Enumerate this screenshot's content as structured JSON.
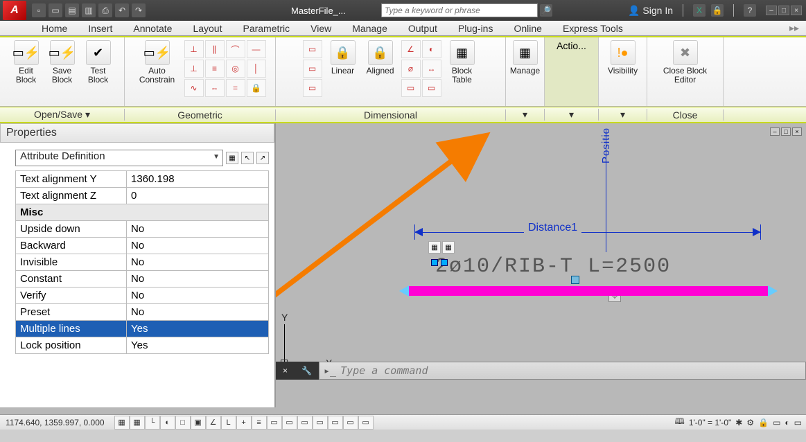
{
  "titlebar": {
    "app_initial": "A",
    "filename": "MasterFile_...",
    "search_placeholder": "Type a keyword or phrase",
    "sign_in": "Sign In"
  },
  "menubar": [
    "Home",
    "Insert",
    "Annotate",
    "Layout",
    "Parametric",
    "View",
    "Manage",
    "Output",
    "Plug-ins",
    "Online",
    "Express Tools"
  ],
  "ribbon": {
    "edit_block": "Edit Block",
    "save_block": "Save Block",
    "test_block": "Test Block",
    "auto_constrain": "Auto Constrain",
    "linear": "Linear",
    "aligned": "Aligned",
    "block_table": "Block Table",
    "manage": "Manage",
    "actio": "Actio...",
    "visibility": "Visibility",
    "close_be": "Close Block Editor",
    "panels": {
      "open_save": "Open/Save",
      "geometric": "Geometric",
      "dimensional": "Dimensional",
      "close": "Close"
    },
    "panel_widths": {
      "open_save": 180,
      "geometric": 218,
      "dimensional": 332,
      "manage": 56,
      "actio": 78,
      "visibility": 70,
      "close": 110
    }
  },
  "properties": {
    "title": "Properties",
    "object_selector": "Attribute Definition",
    "rows": [
      {
        "label": "Text alignment Y",
        "value": "1360.198"
      },
      {
        "label": "Text alignment Z",
        "value": "0"
      }
    ],
    "category": "Misc",
    "misc_rows": [
      {
        "label": "Upside down",
        "value": "No"
      },
      {
        "label": "Backward",
        "value": "No"
      },
      {
        "label": "Invisible",
        "value": "No"
      },
      {
        "label": "Constant",
        "value": "No"
      },
      {
        "label": "Verify",
        "value": "No"
      },
      {
        "label": "Preset",
        "value": "No"
      },
      {
        "label": "Multiple lines",
        "value": "Yes",
        "selected": true
      },
      {
        "label": "Lock position",
        "value": "Yes"
      }
    ]
  },
  "canvas": {
    "position_label": "Positio",
    "distance_label": "Distance1",
    "rebar_prefix": "2ø10",
    "rebar_mid": "/RIB-T",
    "rebar_l": " L=",
    "rebar_value": "2500",
    "axis_x": "X",
    "axis_y": "Y"
  },
  "command": {
    "placeholder": "Type a command"
  },
  "status": {
    "coords": "1174.640, 1359.997, 0.000",
    "scale": "1'-0\" = 1'-0\""
  }
}
